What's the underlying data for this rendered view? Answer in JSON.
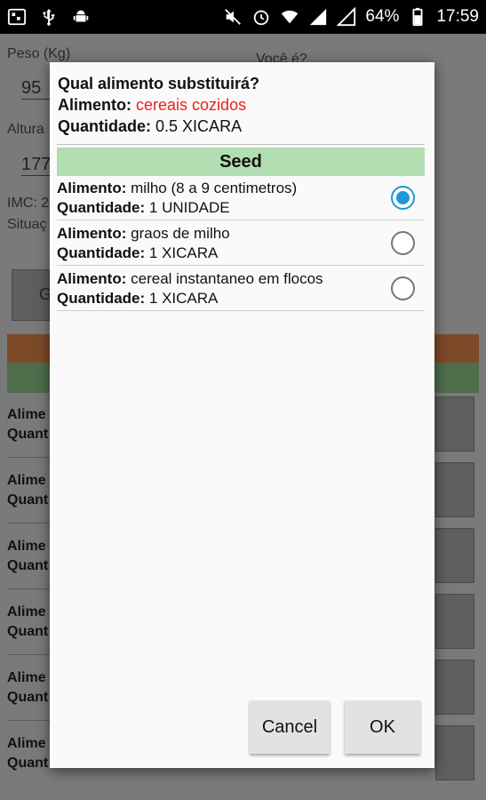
{
  "status_bar": {
    "battery": "64%",
    "time": "17:59",
    "icons": [
      "bbm-icon",
      "usb-icon",
      "android-debug-icon",
      "mute-icon",
      "alarm-icon",
      "wifi-icon",
      "signal-4g-icon",
      "signal-2g-icon",
      "battery-icon"
    ]
  },
  "background": {
    "peso_label": "Peso (Kg)",
    "peso_value": "95",
    "voce_label": "Você é?",
    "altura_label": "Altura",
    "altura_value": "177",
    "imc_label": "IMC: 2",
    "situacao_label": "Situaç",
    "button_label": "G",
    "rows": [
      {
        "line1": "Alime",
        "line2": "Quant"
      },
      {
        "line1": "Alime",
        "line2": "Quant"
      },
      {
        "line1": "Alime",
        "line2": "Quant"
      },
      {
        "line1": "Alime",
        "line2": "Quant"
      },
      {
        "line1": "Alime",
        "line2": "Quant"
      },
      {
        "line1": "Alime",
        "line2": "Quant"
      }
    ]
  },
  "dialog": {
    "title": "Qual alimento substituirá?",
    "alimento_label": "Alimento:",
    "alimento_value": "cereais cozidos",
    "quantidade_label": "Quantidade:",
    "quantidade_value": "0.5 XICARA",
    "group_header": "Seed",
    "options": [
      {
        "alimento_label": "Alimento:",
        "alimento": "milho (8 a 9 centimetros)",
        "quantidade_label": "Quantidade:",
        "quantidade": "1 UNIDADE",
        "selected": true
      },
      {
        "alimento_label": "Alimento:",
        "alimento": "graos de milho",
        "quantidade_label": "Quantidade:",
        "quantidade": "1 XICARA",
        "selected": false
      },
      {
        "alimento_label": "Alimento:",
        "alimento": "cereal instantaneo em flocos",
        "quantidade_label": "Quantidade:",
        "quantidade": "1 XICARA",
        "selected": false
      }
    ],
    "cancel_label": "Cancel",
    "ok_label": "OK"
  },
  "colors": {
    "accent_radio": "#2196d8",
    "seed_header_bg": "#b1ddb1",
    "alimento_value": "#e8221e"
  }
}
